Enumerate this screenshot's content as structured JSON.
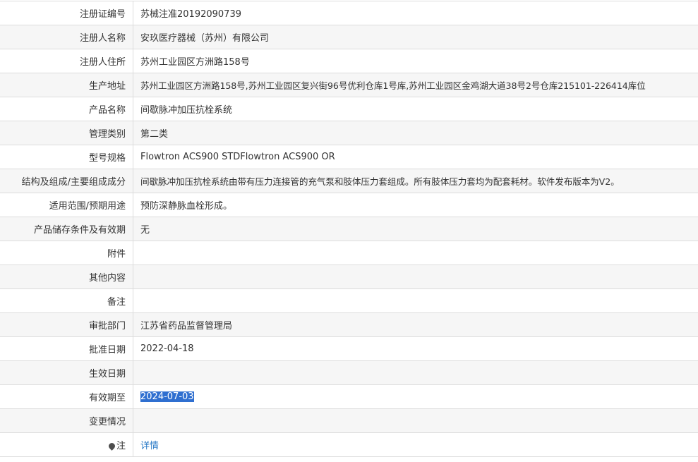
{
  "rows": [
    {
      "label": "注册证编号",
      "value": "苏械注准20192090739"
    },
    {
      "label": "注册人名称",
      "value": "安玖医疗器械（苏州）有限公司"
    },
    {
      "label": "注册人住所",
      "value": "苏州工业园区方洲路158号"
    },
    {
      "label": "生产地址",
      "value": "苏州工业园区方洲路158号,苏州工业园区复兴街96号优利仓库1号库,苏州工业园区金鸡湖大道38号2号仓库215101-226414库位"
    },
    {
      "label": "产品名称",
      "value": "间歇脉冲加压抗栓系统"
    },
    {
      "label": "管理类别",
      "value": "第二类"
    },
    {
      "label": "型号规格",
      "value": "Flowtron ACS900 STDFlowtron ACS900 OR"
    },
    {
      "label": "结构及组成/主要组成成分",
      "value": "间歇脉冲加压抗栓系统由带有压力连接管的充气泵和肢体压力套组成。所有肢体压力套均为配套耗材。软件发布版本为V2。"
    },
    {
      "label": "适用范围/预期用途",
      "value": "预防深静脉血栓形成。"
    },
    {
      "label": "产品储存条件及有效期",
      "value": "无"
    },
    {
      "label": "附件",
      "value": ""
    },
    {
      "label": "其他内容",
      "value": ""
    },
    {
      "label": "备注",
      "value": ""
    },
    {
      "label": "审批部门",
      "value": "江苏省药品监督管理局"
    },
    {
      "label": "批准日期",
      "value": "2022-04-18"
    },
    {
      "label": "生效日期",
      "value": ""
    },
    {
      "label": "有效期至",
      "value": "2024-07-03"
    },
    {
      "label": "变更情况",
      "value": ""
    },
    {
      "label": "注",
      "value": "详情",
      "icon": "pin-icon"
    }
  ]
}
